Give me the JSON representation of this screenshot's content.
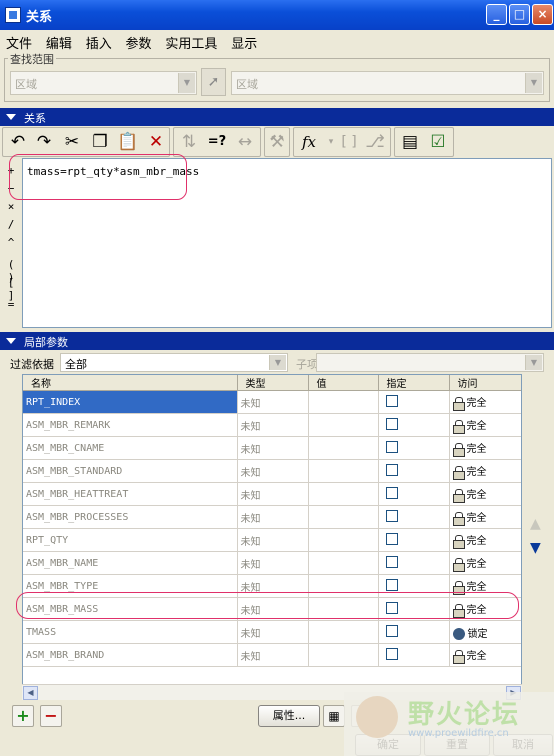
{
  "window": {
    "title": "关系",
    "controls": {
      "min": "_",
      "max": "□",
      "close": "×"
    }
  },
  "menu": [
    "文件",
    "编辑",
    "插入",
    "参数",
    "实用工具",
    "显示"
  ],
  "search_scope": {
    "label": "查找范围",
    "left_value": "区域",
    "right_value": "区域"
  },
  "relations": {
    "header": "关系",
    "toolbar_icons": [
      "undo-icon",
      "redo-icon",
      "cut-icon",
      "copy-icon",
      "paste-icon",
      "delete-icon",
      "sort-relations-icon",
      "evaluate-icon",
      "measure-icon",
      "verify-icon",
      "function-icon",
      "brackets-icon",
      "param-icon",
      "show-relations-icon",
      "check-icon"
    ],
    "toolbar_text": {
      "evaluate": "=?",
      "function": "fx",
      "brackets": "[ ]"
    },
    "operators": [
      "+",
      "−",
      "×",
      "/",
      "^",
      "( )",
      "[ ]",
      "="
    ],
    "editor_text": "tmass=rpt_qty*asm_mbr_mass"
  },
  "local_params": {
    "header": "局部参数",
    "filter_label": "过滤依据",
    "filter_value": "全部",
    "subitem_label": "子项",
    "columns": [
      "名称",
      "类型",
      "值",
      "指定",
      "访问"
    ],
    "rows": [
      {
        "name": "RPT_INDEX",
        "type": "未知",
        "value": "",
        "access": "完全",
        "selected": true
      },
      {
        "name": "ASM_MBR_REMARK",
        "type": "未知",
        "value": "",
        "access": "完全"
      },
      {
        "name": "ASM_MBR_CNAME",
        "type": "未知",
        "value": "",
        "access": "完全"
      },
      {
        "name": "ASM_MBR_STANDARD",
        "type": "未知",
        "value": "",
        "access": "完全"
      },
      {
        "name": "ASM_MBR_HEATTREAT",
        "type": "未知",
        "value": "",
        "access": "完全"
      },
      {
        "name": "ASM_MBR_PROCESSES",
        "type": "未知",
        "value": "",
        "access": "完全"
      },
      {
        "name": "RPT_QTY",
        "type": "未知",
        "value": "",
        "access": "完全"
      },
      {
        "name": "ASM_MBR_NAME",
        "type": "未知",
        "value": "",
        "access": "完全"
      },
      {
        "name": "ASM_MBR_TYPE",
        "type": "未知",
        "value": "",
        "access": "完全"
      },
      {
        "name": "ASM_MBR_MASS",
        "type": "未知",
        "value": "",
        "access": "完全"
      },
      {
        "name": "TMASS",
        "type": "未知",
        "value": "",
        "access": "锁定"
      },
      {
        "name": "ASM_MBR_BRAND",
        "type": "未知",
        "value": "",
        "access": "完全"
      }
    ]
  },
  "buttons": {
    "add": "+",
    "remove": "−",
    "properties": "属性...",
    "ok": "确定",
    "reset": "重置",
    "cancel": "取消"
  },
  "watermark": {
    "text": "野火论坛",
    "url": "www.proewildfire.cn"
  },
  "colors": {
    "title_bar": "#0a4fd8",
    "section_header": "#0a2b9a",
    "selection": "#316ac5",
    "annotation": "#e0306a"
  }
}
